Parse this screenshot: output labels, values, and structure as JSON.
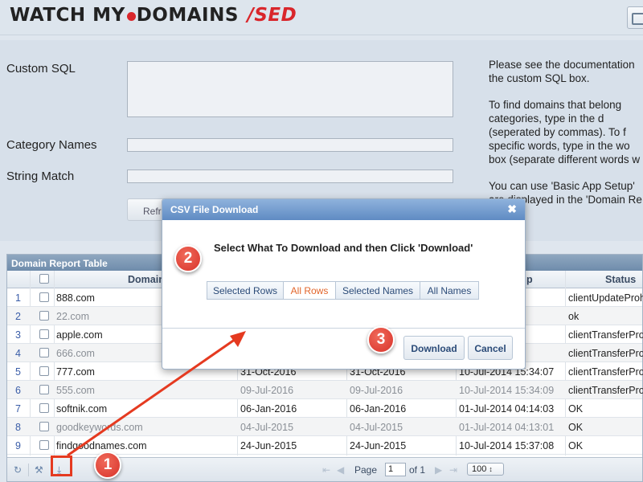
{
  "brand": {
    "logo_main": "WATCH MY",
    "logo_domains": "DOMAINS",
    "logo_suffix": "/SED"
  },
  "form": {
    "custom_sql_label": "Custom SQL",
    "category_names_label": "Category Names",
    "string_match_label": "String Match",
    "refresh_button": "Refr"
  },
  "help": {
    "lines": [
      "Please see the documentation",
      "the custom SQL box.",
      "To find domains that belong",
      "categories, type in the d",
      "(seperated by commas). To f",
      "specific words, type in the wo",
      "box (separate different words w",
      "You can use 'Basic App Setup'",
      "are displayed in the 'Domain Re"
    ]
  },
  "grid": {
    "caption": "Domain Report Table",
    "columns": [
      "Domain",
      "p",
      "Status"
    ],
    "rows": [
      {
        "num": "1",
        "domain": "888.com",
        "d1": "",
        "d2": "",
        "ts": "5:34:09",
        "status": "clientUpdateProhi"
      },
      {
        "num": "2",
        "domain": "22.com",
        "d1": "",
        "d2": "",
        "ts": "5:33:06",
        "status": "ok"
      },
      {
        "num": "3",
        "domain": "apple.com",
        "d1": "",
        "d2": "",
        "ts": "5:13:00",
        "status": "clientTransferProh"
      },
      {
        "num": "4",
        "domain": "666.com",
        "d1": "",
        "d2": "",
        "ts": "5:34:08",
        "status": "clientTransferProh"
      },
      {
        "num": "5",
        "domain": "777.com",
        "d1": "31-Oct-2016",
        "d2": "31-Oct-2016",
        "ts": "10-Jul-2014 15:34:07",
        "status": "clientTransferProh"
      },
      {
        "num": "6",
        "domain": "555.com",
        "d1": "09-Jul-2016",
        "d2": "09-Jul-2016",
        "ts": "10-Jul-2014 15:34:09",
        "status": "clientTransferProh"
      },
      {
        "num": "7",
        "domain": "softnik.com",
        "d1": "06-Jan-2016",
        "d2": "06-Jan-2016",
        "ts": "01-Jul-2014 04:14:03",
        "status": "OK"
      },
      {
        "num": "8",
        "domain": "goodkeywords.com",
        "d1": "04-Jul-2015",
        "d2": "04-Jul-2015",
        "ts": "01-Jul-2014 04:13:01",
        "status": "OK"
      },
      {
        "num": "9",
        "domain": "findgoodnames.com",
        "d1": "24-Jun-2015",
        "d2": "24-Jun-2015",
        "ts": "10-Jul-2014 15:37:08",
        "status": "OK"
      }
    ]
  },
  "pager": {
    "page_label": "Page",
    "page_value": "1",
    "of_label": "of 1",
    "page_size": "100"
  },
  "dialog": {
    "title": "CSV File Download",
    "instruction": "Select What To Download and then Click 'Download'",
    "options": [
      "Selected Rows",
      "All Rows",
      "Selected Names",
      "All Names"
    ],
    "active_option": "All Rows",
    "download_button": "Download",
    "cancel_button": "Cancel"
  },
  "annotations": {
    "step1": "1",
    "step2": "2",
    "step3": "3",
    "color": "#e53a20"
  }
}
